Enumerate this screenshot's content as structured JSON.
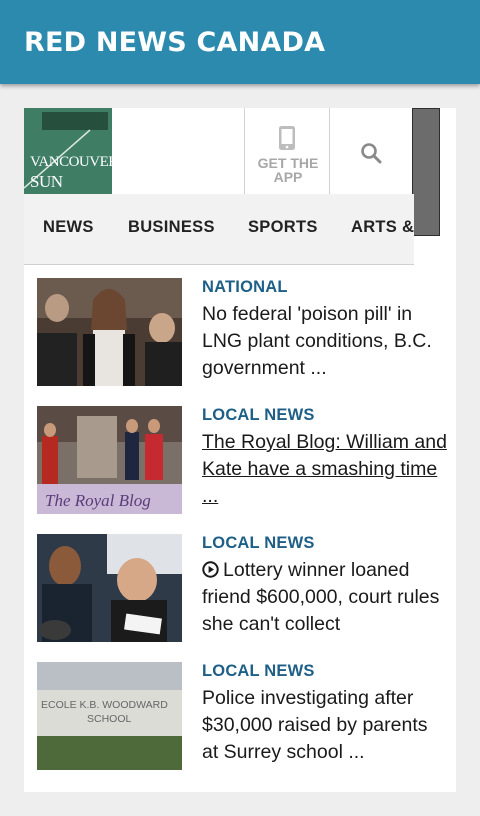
{
  "app_bar": {
    "title": "RED NEWS CANADA"
  },
  "site_header": {
    "logo_line1": "VANCOUVER",
    "logo_line2": "SUN",
    "get_app_line1": "GET THE",
    "get_app_line2": "APP",
    "icons": {
      "phone": "smartphone-icon",
      "search": "search-icon"
    }
  },
  "nav": {
    "items": [
      "NEWS",
      "BUSINESS",
      "SPORTS",
      "ARTS &"
    ]
  },
  "articles": [
    {
      "category": "NATIONAL",
      "headline": "No federal 'poison pill' in LNG plant conditions, B.C. government ...",
      "video": false,
      "underlined": false
    },
    {
      "category": "LOCAL NEWS",
      "headline": "The Royal Blog: William and Kate have a smashing time ...",
      "thumb_caption": "The Royal Blog",
      "video": false,
      "underlined": true
    },
    {
      "category": "LOCAL NEWS",
      "headline": "Lottery winner loaned friend $600,000, court rules she can't collect",
      "video": true,
      "underlined": false
    },
    {
      "category": "LOCAL NEWS",
      "headline": "Police investigating after $30,000 raised by parents at Surrey school ...",
      "thumb_caption": "ECOLE K.B. WOODWARD SCHOOL",
      "video": false,
      "underlined": false
    }
  ],
  "colors": {
    "app_bar": "#2b8aad",
    "category": "#1d5f86",
    "logo_green": "#3f7d64"
  }
}
